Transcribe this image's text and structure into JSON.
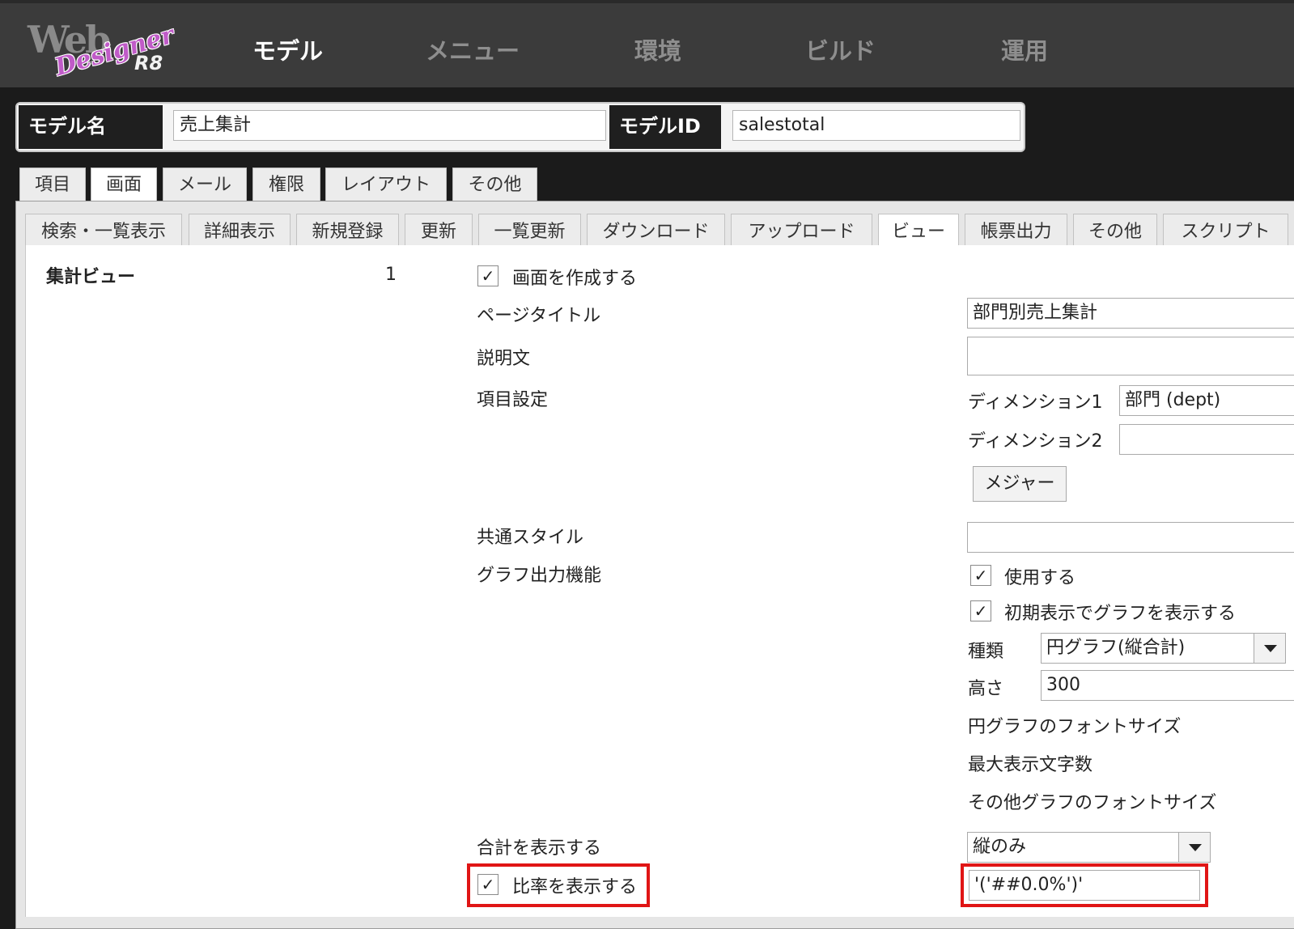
{
  "logo": {
    "wordmark": "Web",
    "script": "Designer",
    "version": "R8"
  },
  "nav": {
    "model": "モデル",
    "menu": "メニュー",
    "environment": "環境",
    "build": "ビルド",
    "operation": "運用"
  },
  "model": {
    "name_label": "モデル名",
    "name_value": "売上集計",
    "id_label": "モデルID",
    "id_value": "salestotal"
  },
  "tabs": [
    "項目",
    "画面",
    "メール",
    "権限",
    "レイアウト",
    "その他"
  ],
  "subtabs": [
    "検索・一覧表示",
    "詳細表示",
    "新規登録",
    "更新",
    "一覧更新",
    "ダウンロード",
    "アップロード",
    "ビュー",
    "帳票出力",
    "その他",
    "スクリプト"
  ],
  "view": {
    "section_title": "集計ビュー",
    "index": "1",
    "create_screen_label": "画面を作成する",
    "create_screen_checked": true,
    "page_title_label": "ページタイトル",
    "page_title_value": "部門別売上集計",
    "description_label": "説明文",
    "description_value": "",
    "item_settings_label": "項目設定",
    "dimension1_label": "ディメンション1",
    "dimension1_value": "部門 (dept)",
    "dimension2_label": "ディメンション2",
    "dimension2_value": "",
    "measure_button": "メジャー",
    "common_style_label": "共通スタイル",
    "common_style_value": "",
    "graph_label": "グラフ出力機能",
    "use_label": "使用する",
    "use_checked": true,
    "initial_graph_label": "初期表示でグラフを表示する",
    "initial_graph_checked": true,
    "type_label": "種類",
    "type_value": "円グラフ(縦合計)",
    "height_label": "高さ",
    "height_value": "300",
    "pie_font_size_label": "円グラフのフォントサイズ",
    "max_chars_label": "最大表示文字数",
    "other_font_size_label": "その他グラフのフォントサイズ",
    "show_total_label": "合計を表示する",
    "show_total_value": "縦のみ",
    "show_ratio_label": "比率を表示する",
    "show_ratio_checked": true,
    "ratio_format_value": "'('##0.0%')'"
  },
  "colors": {
    "highlight": "#e01515",
    "topbar": "#3b3b3b",
    "logo_script": "#c05bc8"
  }
}
